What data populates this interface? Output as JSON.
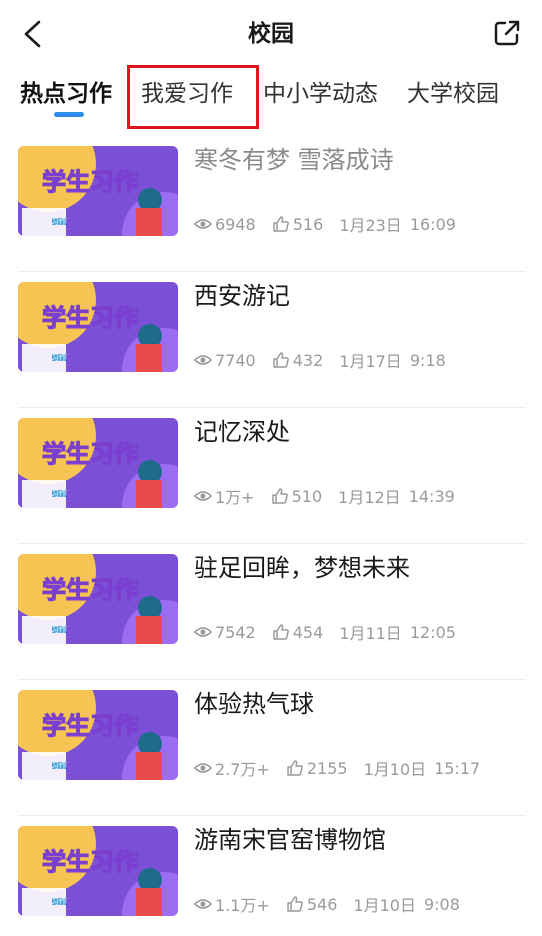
{
  "header": {
    "title": "校园"
  },
  "tabs": [
    {
      "label": "热点习作",
      "active": true
    },
    {
      "label": "我爱习作",
      "active": false
    },
    {
      "label": "中小学动态",
      "active": false
    },
    {
      "label": "大学校园",
      "active": false
    }
  ],
  "thumbnail": {
    "banner_text": "学生习作",
    "badge_text": "习作"
  },
  "articles": [
    {
      "title": "寒冬有梦  雪落成诗",
      "views": "6948",
      "likes": "516",
      "date": "1月23日",
      "time": "16:09",
      "read": true
    },
    {
      "title": "西安游记",
      "views": "7740",
      "likes": "432",
      "date": "1月17日",
      "time": "9:18",
      "read": false
    },
    {
      "title": "记忆深处",
      "views": "1万+",
      "likes": "510",
      "date": "1月12日",
      "time": "14:39",
      "read": false
    },
    {
      "title": "驻足回眸，梦想未来",
      "views": "7542",
      "likes": "454",
      "date": "1月11日",
      "time": "12:05",
      "read": false
    },
    {
      "title": "体验热气球",
      "views": "2.7万+",
      "likes": "2155",
      "date": "1月10日",
      "time": "15:17",
      "read": false
    },
    {
      "title": "游南宋官窑博物馆",
      "views": "1.1万+",
      "likes": "546",
      "date": "1月10日",
      "time": "9:08",
      "read": false
    }
  ],
  "colors": {
    "accent": "#2f8fe8",
    "highlight": "#e0141b",
    "thumb_bg": "#7b4fd6"
  }
}
